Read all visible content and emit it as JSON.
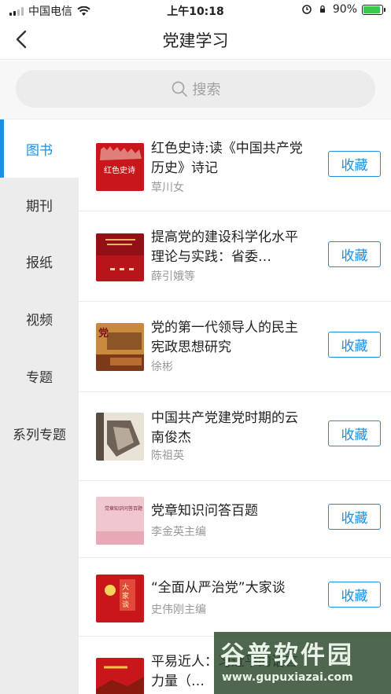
{
  "status_bar": {
    "carrier": "中国电信",
    "time": "上午10:18",
    "battery": "90%",
    "battery_level": 0.9
  },
  "nav": {
    "title": "党建学习"
  },
  "search": {
    "placeholder": "搜索"
  },
  "sidebar": {
    "items": [
      {
        "label": "图书",
        "active": true
      },
      {
        "label": "期刊"
      },
      {
        "label": "报纸"
      },
      {
        "label": "视频"
      },
      {
        "label": "专题"
      },
      {
        "label": "系列专题"
      }
    ]
  },
  "books": [
    {
      "title": "红色史诗:读《中国共产党历史》诗记",
      "author": "草川女",
      "cover_text": "红色史诗",
      "cover_color": "#c9161b"
    },
    {
      "title": "提高党的建设科学化水平理论与实践：省委…",
      "author": "薛引娥等",
      "cover_text": "",
      "cover_color": "#b8141c"
    },
    {
      "title": "党的第一代领导人的民主宪政思想研究",
      "author": "徐彬",
      "cover_text": "党",
      "cover_color": "#c98a3e"
    },
    {
      "title": "中国共产党建党时期的云南俊杰",
      "author": "陈祖英",
      "cover_text": "",
      "cover_color": "#8a7a6a"
    },
    {
      "title": "党章知识问答百题",
      "author": "李金英主编",
      "cover_text": "党章知识问答百题",
      "cover_color": "#f0c6cf"
    },
    {
      "title": "“全面从严治党”大家谈",
      "author": "史伟刚主编",
      "cover_text": "大家谈",
      "cover_color": "#c9161b"
    },
    {
      "title": "平易近人：习近平的语言力量（…",
      "author": "",
      "cover_text": "",
      "cover_color": "#c9161b"
    }
  ],
  "fav_label": "收藏",
  "watermark": {
    "main": "谷普软件园",
    "sub": "www.gupuxiazai.com"
  },
  "colors": {
    "accent": "#1a8fe3",
    "sidebar_bg": "#ececec"
  }
}
